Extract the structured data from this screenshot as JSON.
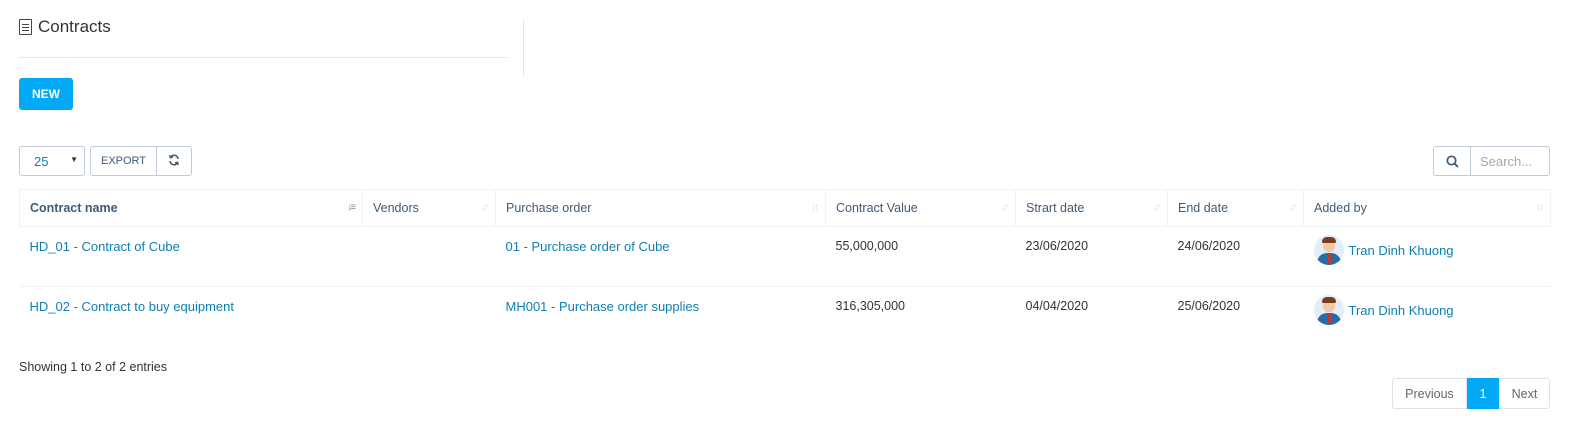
{
  "header": {
    "title": "Contracts",
    "icon": "document-icon"
  },
  "actions": {
    "new_label": "NEW"
  },
  "toolbar": {
    "page_length": "25",
    "export_label": "EXPORT",
    "refresh_icon": "refresh-icon"
  },
  "search": {
    "placeholder": "Search...",
    "icon": "search-icon"
  },
  "table": {
    "columns": [
      "Contract name",
      "Vendors",
      "Purchase order",
      "Contract Value",
      "Strart date",
      "End date",
      "Added by"
    ],
    "rows": [
      {
        "contract_name": "HD_01 - Contract of Cube",
        "vendors": "",
        "purchase_order": "01 - Purchase order of Cube",
        "contract_value": "55,000,000",
        "start_date": "23/06/2020",
        "end_date": "24/06/2020",
        "added_by": "Tran Dinh Khuong"
      },
      {
        "contract_name": "HD_02 - Contract to buy equipment",
        "vendors": "",
        "purchase_order": "MH001 - Purchase order supplies",
        "contract_value": "316,305,000",
        "start_date": "04/04/2020",
        "end_date": "25/06/2020",
        "added_by": "Tran Dinh Khuong"
      }
    ]
  },
  "footer": {
    "info": "Showing 1 to 2 of 2 entries",
    "pagination": {
      "previous": "Previous",
      "current": "1",
      "next": "Next"
    }
  },
  "colors": {
    "accent": "#03a9f4",
    "link": "#0d7fb5"
  }
}
